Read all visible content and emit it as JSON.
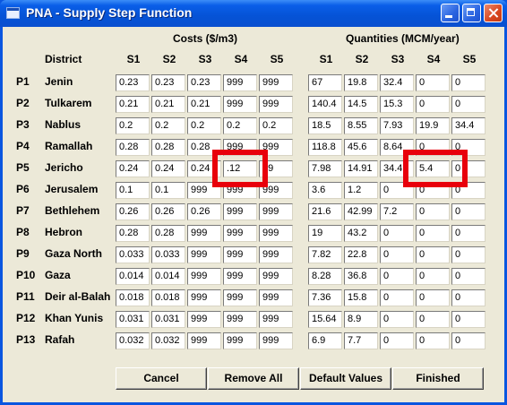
{
  "window": {
    "title": "PNA - Supply Step Function"
  },
  "headers": {
    "costs": "Costs ($/m3)",
    "quantities": "Quantities (MCM/year)",
    "district": "District",
    "cost_cols": [
      "S1",
      "S2",
      "S3",
      "S4",
      "S5"
    ],
    "qty_cols": [
      "S1",
      "S2",
      "S3",
      "S4",
      "S5"
    ]
  },
  "rows": [
    {
      "id": "P1",
      "name": "Jenin",
      "costs": [
        "0.23",
        "0.23",
        "0.23",
        "999",
        "999"
      ],
      "quantities": [
        "67",
        "19.8",
        "32.4",
        "0",
        "0"
      ]
    },
    {
      "id": "P2",
      "name": "Tulkarem",
      "costs": [
        "0.21",
        "0.21",
        "0.21",
        "999",
        "999"
      ],
      "quantities": [
        "140.4",
        "14.5",
        "15.3",
        "0",
        "0"
      ]
    },
    {
      "id": "P3",
      "name": "Nablus",
      "costs": [
        "0.2",
        "0.2",
        "0.2",
        "0.2",
        "0.2"
      ],
      "quantities": [
        "18.5",
        "8.55",
        "7.93",
        "19.9",
        "34.4"
      ]
    },
    {
      "id": "P4",
      "name": "Ramallah",
      "costs": [
        "0.28",
        "0.28",
        "0.28",
        "999",
        "999"
      ],
      "quantities": [
        "118.8",
        "45.6",
        "8.64",
        "0",
        "0"
      ]
    },
    {
      "id": "P5",
      "name": "Jericho",
      "costs": [
        "0.24",
        "0.24",
        "0.24",
        ".12",
        "99"
      ],
      "quantities": [
        "7.98",
        "14.91",
        "34.4",
        "5.4",
        "0"
      ]
    },
    {
      "id": "P6",
      "name": "Jerusalem",
      "costs": [
        "0.1",
        "0.1",
        "999",
        "999",
        "999"
      ],
      "quantities": [
        "3.6",
        "1.2",
        "0",
        "0",
        "0"
      ]
    },
    {
      "id": "P7",
      "name": "Bethlehem",
      "costs": [
        "0.26",
        "0.26",
        "0.26",
        "999",
        "999"
      ],
      "quantities": [
        "21.6",
        "42.99",
        "7.2",
        "0",
        "0"
      ]
    },
    {
      "id": "P8",
      "name": "Hebron",
      "costs": [
        "0.28",
        "0.28",
        "999",
        "999",
        "999"
      ],
      "quantities": [
        "19",
        "43.2",
        "0",
        "0",
        "0"
      ]
    },
    {
      "id": "P9",
      "name": "Gaza North",
      "costs": [
        "0.033",
        "0.033",
        "999",
        "999",
        "999"
      ],
      "quantities": [
        "7.82",
        "22.8",
        "0",
        "0",
        "0"
      ]
    },
    {
      "id": "P10",
      "name": "Gaza",
      "costs": [
        "0.014",
        "0.014",
        "999",
        "999",
        "999"
      ],
      "quantities": [
        "8.28",
        "36.8",
        "0",
        "0",
        "0"
      ]
    },
    {
      "id": "P11",
      "name": "Deir al-Balah",
      "costs": [
        "0.018",
        "0.018",
        "999",
        "999",
        "999"
      ],
      "quantities": [
        "7.36",
        "15.8",
        "0",
        "0",
        "0"
      ]
    },
    {
      "id": "P12",
      "name": "Khan Yunis",
      "costs": [
        "0.031",
        "0.031",
        "999",
        "999",
        "999"
      ],
      "quantities": [
        "15.64",
        "8.9",
        "0",
        "0",
        "0"
      ]
    },
    {
      "id": "P13",
      "name": "Rafah",
      "costs": [
        "0.032",
        "0.032",
        "999",
        "999",
        "999"
      ],
      "quantities": [
        "6.9",
        "7.7",
        "0",
        "0",
        "0"
      ]
    }
  ],
  "buttons": {
    "cancel": "Cancel",
    "remove_all": "Remove All",
    "default_values": "Default Values",
    "finished": "Finished"
  },
  "highlight_color": "#e8000b"
}
